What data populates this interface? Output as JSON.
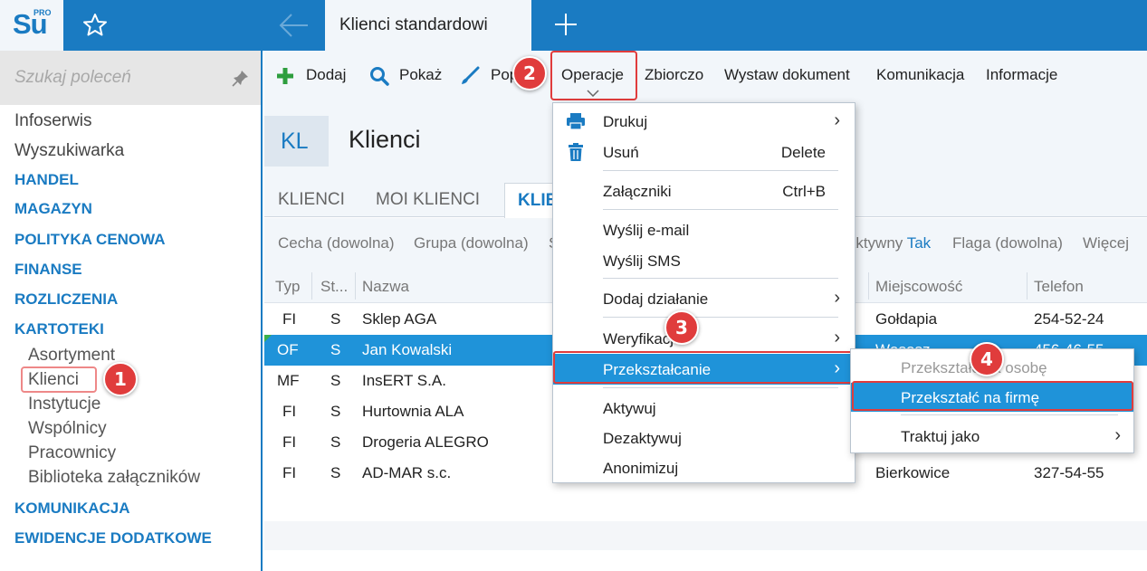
{
  "app": {
    "logo_main": "Su",
    "logo_sup": "PRO",
    "active_tab_title": "Klienci standardowi"
  },
  "sidebar": {
    "search_placeholder": "Szukaj poleceń",
    "top_items": [
      "Infoserwis",
      "Wyszukiwarka"
    ],
    "sections": [
      "HANDEL",
      "MAGAZYN",
      "POLITYKA CENOWA",
      "FINANSE",
      "ROZLICZENIA",
      "KARTOTEKI"
    ],
    "kartoteki_items": [
      "Asortyment",
      "Klienci",
      "Instytucje",
      "Wspólnicy",
      "Pracownicy",
      "Biblioteka załączników"
    ],
    "bottom_sections": [
      "KOMUNIKACJA",
      "EWIDENCJE DODATKOWE"
    ]
  },
  "toolbar": {
    "add": "Dodaj",
    "show": "Pokaż",
    "fix": "Popraw",
    "operations": "Operacje",
    "bulk": "Zbiorczo",
    "issue_doc": "Wystaw dokument",
    "communication": "Komunikacja",
    "info": "Informacje"
  },
  "header": {
    "badge": "KL",
    "title": "Klienci"
  },
  "tabs": [
    "KLIENCI",
    "MOI KLIENCI",
    "KLIE"
  ],
  "filters": {
    "feature": "Cecha (dowolna)",
    "group": "Grupa (dowolna)",
    "s": "S",
    "active_label": "Aktywny",
    "active_value": "Tak",
    "flag": "Flaga (dowolna)",
    "more": "Więcej"
  },
  "grid": {
    "columns": [
      "Typ",
      "St...",
      "Nazwa",
      "Miejscowość",
      "Telefon"
    ],
    "rows": [
      {
        "typ": "FI",
        "st": "S",
        "nazwa": "Sklep AGA",
        "miejscowosc": "Gołdapia",
        "telefon": "254-52-24"
      },
      {
        "typ": "OF",
        "st": "S",
        "nazwa": "Jan Kowalski",
        "miejscowosc": "Wąsosz",
        "telefon": "456-46-55"
      },
      {
        "typ": "MF",
        "st": "S",
        "nazwa": "InsERT S.A.",
        "miejscowosc": "",
        "telefon": ""
      },
      {
        "typ": "FI",
        "st": "S",
        "nazwa": "Hurtownia ALA",
        "miejscowosc": "",
        "telefon": ""
      },
      {
        "typ": "FI",
        "st": "S",
        "nazwa": "Drogeria ALEGRO",
        "miejscowosc": "",
        "telefon": ""
      },
      {
        "typ": "FI",
        "st": "S",
        "nazwa": "AD-MAR s.c.",
        "miejscowosc": "Bierkowice",
        "telefon": "327-54-55"
      }
    ]
  },
  "menu": {
    "print": "Drukuj",
    "delete": "Usuń",
    "delete_shortcut": "Delete",
    "attachments": "Załączniki",
    "attachments_shortcut": "Ctrl+B",
    "send_email": "Wyślij e-mail",
    "send_sms": "Wyślij SMS",
    "add_action": "Dodaj działanie",
    "verification": "Weryfikacja",
    "transform": "Przekształcanie",
    "activate": "Aktywuj",
    "deactivate": "Dezaktywuj",
    "anonymize": "Anonimizuj"
  },
  "submenu": {
    "to_person": "Przekształć na osobę",
    "to_company": "Przekształć na firmę",
    "treat_as": "Traktuj jako"
  },
  "callouts": [
    "1",
    "2",
    "3",
    "4"
  ],
  "colors": {
    "brand_blue": "#1a7bc2",
    "selection_blue": "#1f93d9",
    "callout_red": "#e03c3c",
    "panel_bg": "#f2f6fa"
  }
}
